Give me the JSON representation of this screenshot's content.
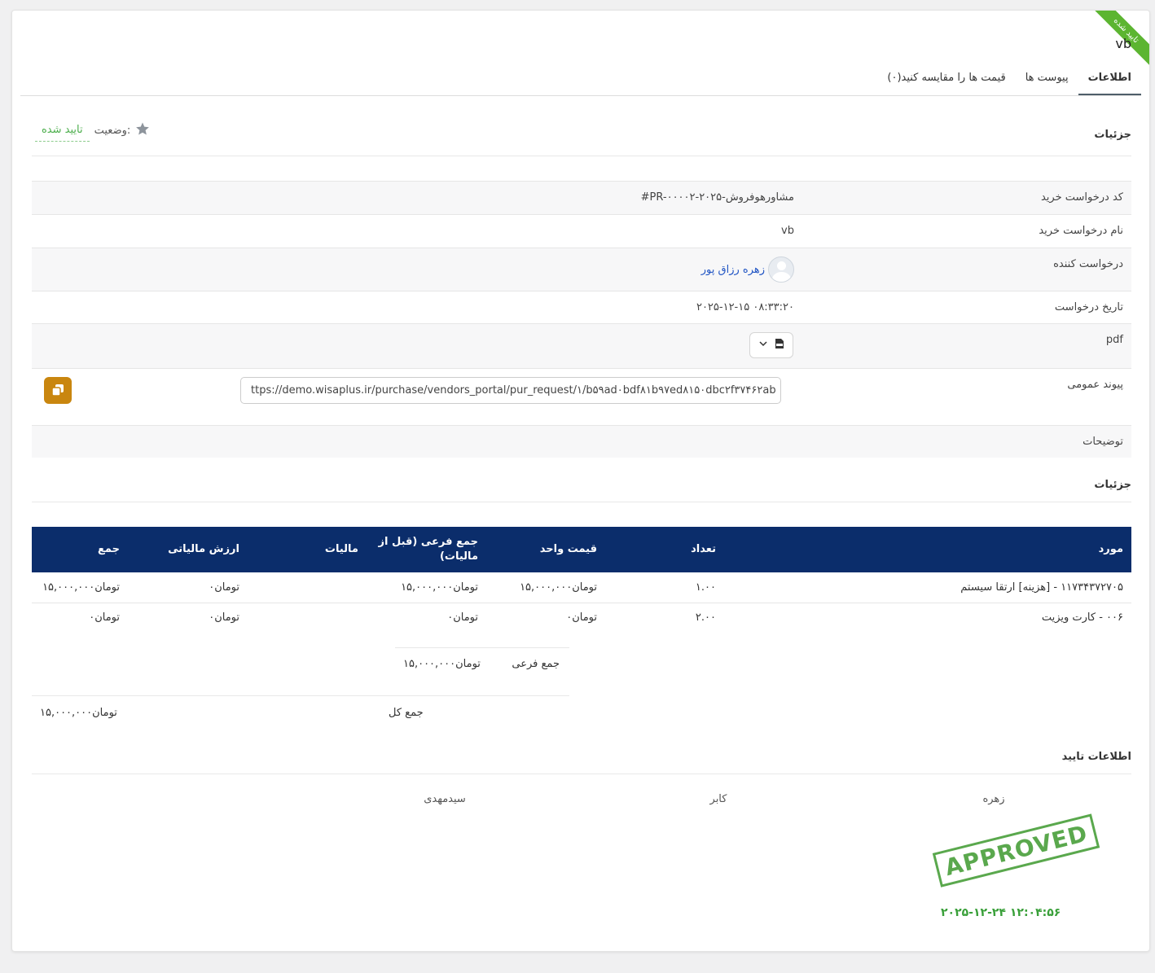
{
  "ribbon": "تایید شده",
  "title": "vb",
  "tabs": [
    {
      "label": "اطلاعات"
    },
    {
      "label": "پیوست ها"
    },
    {
      "label": "قیمت ها را مقایسه کنید(۰)"
    }
  ],
  "details": {
    "heading": "جزئیات",
    "status_label": "وضعیت:",
    "status_value": "تایید شده",
    "rows": {
      "code": {
        "label": "کد درخواست خرید",
        "value": "#PR-۰۰۰۰۲-۲۰۲۵-مشاورهوفروش"
      },
      "name": {
        "label": "نام درخواست خرید",
        "value": "vb"
      },
      "requester": {
        "label": "درخواست کننده",
        "value": "زهره رزاق پور"
      },
      "date": {
        "label": "تاریخ درخواست",
        "value": "۲۰۲۵-۱۲-۱۵ ۰۸:۳۳:۲۰"
      },
      "pdf": {
        "label": "pdf"
      },
      "link": {
        "label": "پیوند عمومی",
        "value": "ttps://demo.wisaplus.ir/purchase/vendors_portal/pur_request/۱/b۵۹ad۰bdf۸۱b۹۷ed۸۱۵۰dbc۲f۳۷۴۶۲ab"
      },
      "notes": {
        "label": "توضیحات"
      }
    }
  },
  "items": {
    "heading": "جزئیات",
    "columns": [
      "مورد",
      "تعداد",
      "قیمت واحد",
      "جمع فرعی (قبل از مالیات)",
      "مالیات",
      "ارزش مالیاتی",
      "جمع"
    ],
    "rows": [
      {
        "item": "۱۱۷۳۴۳۷۲۷۰۵ - [هزینه] ارتقا سیستم",
        "qty": "۱.۰۰",
        "unit": "تومان۱۵,۰۰۰,۰۰۰",
        "subtotal": "تومان۱۵,۰۰۰,۰۰۰",
        "tax": "",
        "tax_value": "تومان۰",
        "total": "تومان۱۵,۰۰۰,۰۰۰"
      },
      {
        "item": "۰۰۶ - کارت ویزیت",
        "qty": "۲.۰۰",
        "unit": "تومان۰",
        "subtotal": "تومان۰",
        "tax": "",
        "tax_value": "تومان۰",
        "total": "تومان۰"
      }
    ],
    "subtotal_label": "جمع فرعی",
    "subtotal_value": "تومان۱۵,۰۰۰,۰۰۰",
    "grand_total_label": "جمع کل",
    "grand_total_value": "تومان۱۵,۰۰۰,۰۰۰"
  },
  "approval": {
    "heading": "اطلاعات تایید",
    "approvers": [
      {
        "name": "زهره",
        "stamp": "APPROVED",
        "time": "۲۰۲۵-۱۲-۲۴ ۱۲:۰۴:۵۶"
      },
      {
        "name": "کابر"
      },
      {
        "name": "سیدمهدی"
      }
    ]
  },
  "colors": {
    "ribbon": "#5cb531",
    "table_header": "#0b2d6b",
    "copy_button": "#c9860f",
    "status": "#4cae4c",
    "link": "#2155c4"
  }
}
